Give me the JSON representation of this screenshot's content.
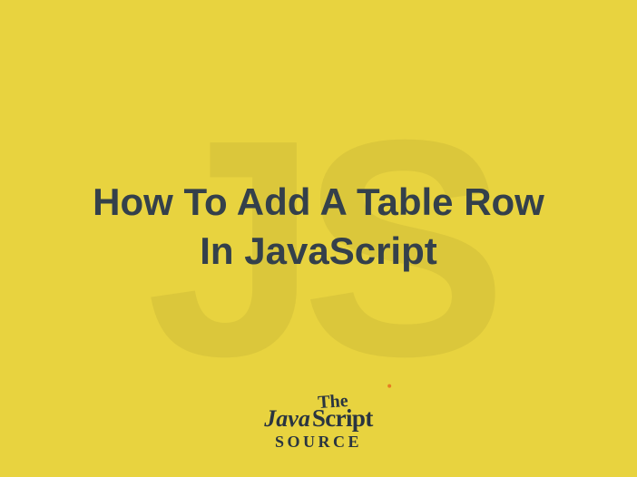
{
  "background_watermark": "JS",
  "title": "How To Add A Table Row In JavaScript",
  "logo": {
    "line1": "The",
    "line2a": "Java",
    "line2b": "Script",
    "line3": "Source"
  },
  "colors": {
    "background": "#e8d33f",
    "text": "#34404b",
    "accent_dot": "#e67e22"
  }
}
